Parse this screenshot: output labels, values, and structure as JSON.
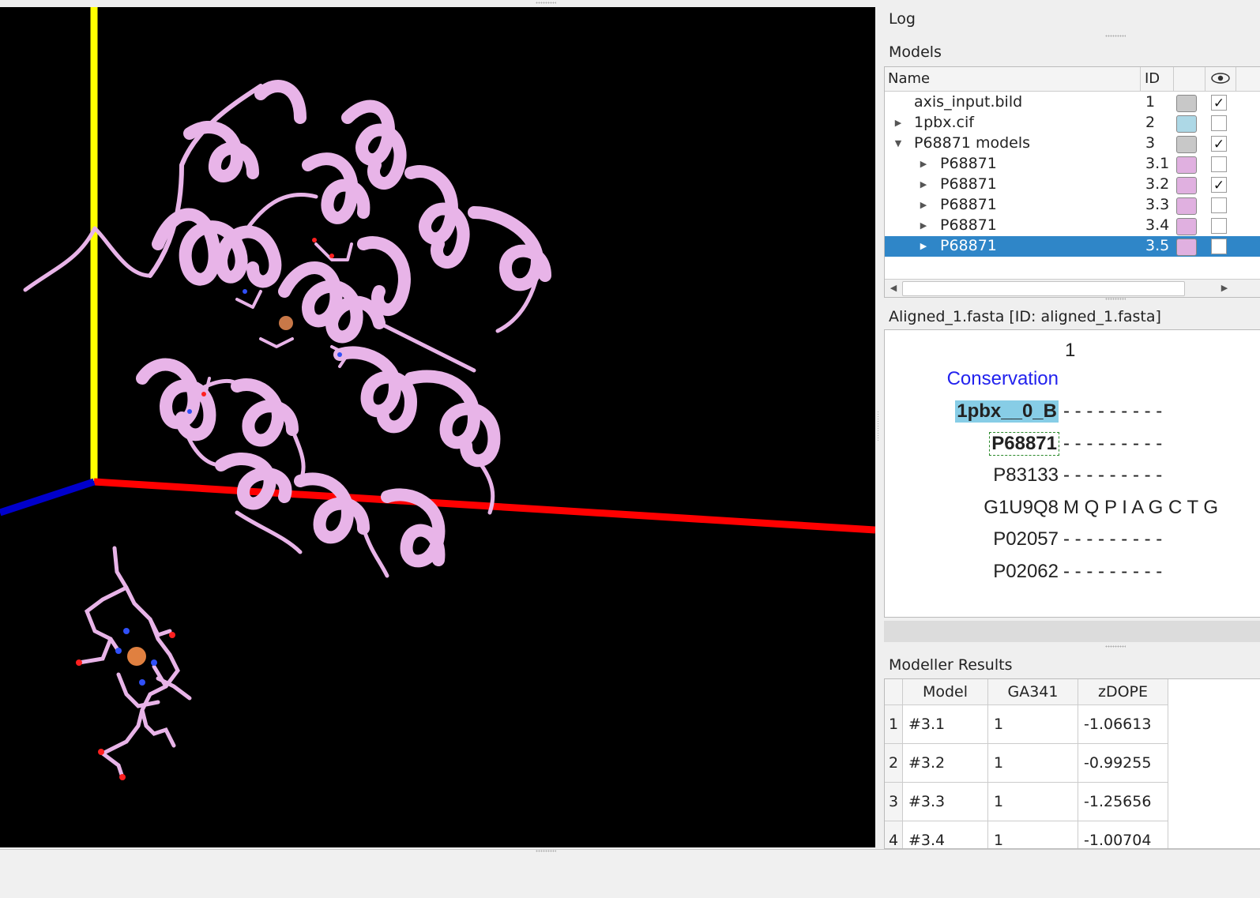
{
  "panels": {
    "log_title": "Log",
    "models_title": "Models",
    "alignment_title": "Aligned_1.fasta [ID: aligned_1.fasta]",
    "results_title": "Modeller Results"
  },
  "models": {
    "header": {
      "name": "Name",
      "id": "ID"
    },
    "rows": [
      {
        "name": "axis_input.bild",
        "id": "1",
        "color": "#c8c8c8",
        "checked": "✓"
      },
      {
        "name": "1pbx.cif",
        "id": "2",
        "color": "#add8e6",
        "checked": ""
      },
      {
        "name": "P68871 models",
        "id": "3",
        "color": "#c8c8c8",
        "checked": "✓"
      },
      {
        "name": "P68871",
        "id": "3.1",
        "color": "#e0b0e0",
        "checked": ""
      },
      {
        "name": "P68871",
        "id": "3.2",
        "color": "#e0b0e0",
        "checked": "✓"
      },
      {
        "name": "P68871",
        "id": "3.3",
        "color": "#e0b0e0",
        "checked": ""
      },
      {
        "name": "P68871",
        "id": "3.4",
        "color": "#e0b0e0",
        "checked": ""
      },
      {
        "name": "P68871",
        "id": "3.5",
        "color": "#e0b0e0",
        "checked": ""
      }
    ]
  },
  "alignment": {
    "column_number": "1",
    "conservation_label": "Conservation",
    "sequences": [
      {
        "name": "1pbx__0_B",
        "residues": "- - - - - - - - -"
      },
      {
        "name": "P68871",
        "residues": "- - - - - - - - -"
      },
      {
        "name": "P83133",
        "residues": "- - - - - - - - -"
      },
      {
        "name": "G1U9Q8",
        "residues": "M Q P I A G C T G"
      },
      {
        "name": "P02057",
        "residues": "- - - - - - - - -"
      },
      {
        "name": "P02062",
        "residues": "- - - - - - - - -"
      }
    ]
  },
  "results": {
    "headers": [
      "Model",
      "GA341",
      "zDOPE"
    ],
    "rows": [
      {
        "n": "1",
        "model": "#3.1",
        "ga341": "1",
        "zdope": "-1.06613"
      },
      {
        "n": "2",
        "model": "#3.2",
        "ga341": "1",
        "zdope": "-0.99255"
      },
      {
        "n": "3",
        "model": "#3.3",
        "ga341": "1",
        "zdope": "-1.25656"
      },
      {
        "n": "4",
        "model": "#3.4",
        "ga341": "1",
        "zdope": "-1.00704"
      }
    ]
  },
  "colors": {
    "ribbon": "#e8b4e8",
    "x_axis": "#ff0000",
    "y_axis": "#ffff00",
    "z_axis": "#0000cc",
    "selection": "#2f86c8"
  }
}
